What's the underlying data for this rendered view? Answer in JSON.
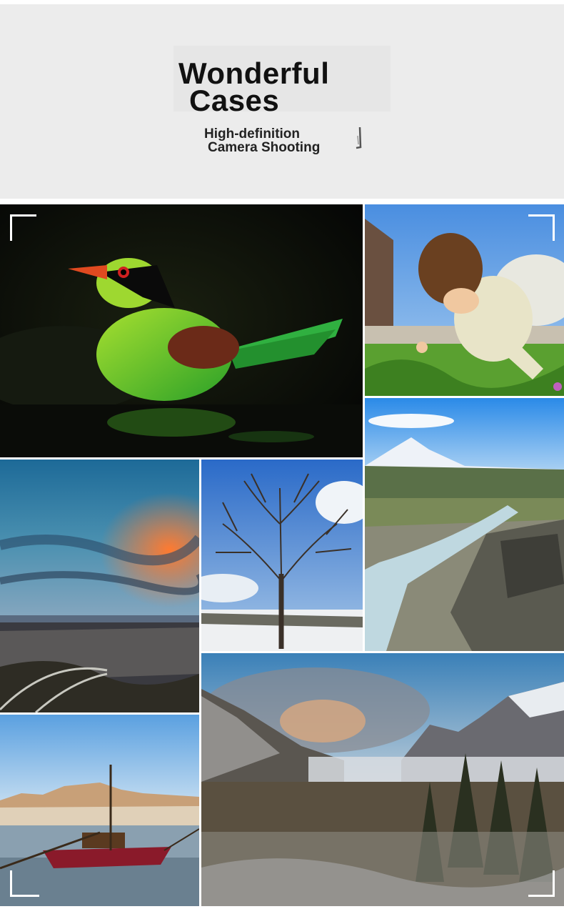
{
  "header": {
    "title_line1": "Wonderful",
    "title_line2": "Cases",
    "subtitle_line1": "High-definition",
    "subtitle_line2": "Camera Shooting"
  },
  "gallery": {
    "photos": [
      {
        "name": "bird-photo"
      },
      {
        "name": "child-photo"
      },
      {
        "name": "mountain-river-photo"
      },
      {
        "name": "city-sunset-photo"
      },
      {
        "name": "winter-tree-photo"
      },
      {
        "name": "harbor-boat-photo"
      },
      {
        "name": "snowy-valley-photo"
      }
    ]
  },
  "colors": {
    "header_bg": "#ececec",
    "title": "#111111",
    "frame_corner": "#ffffff"
  }
}
